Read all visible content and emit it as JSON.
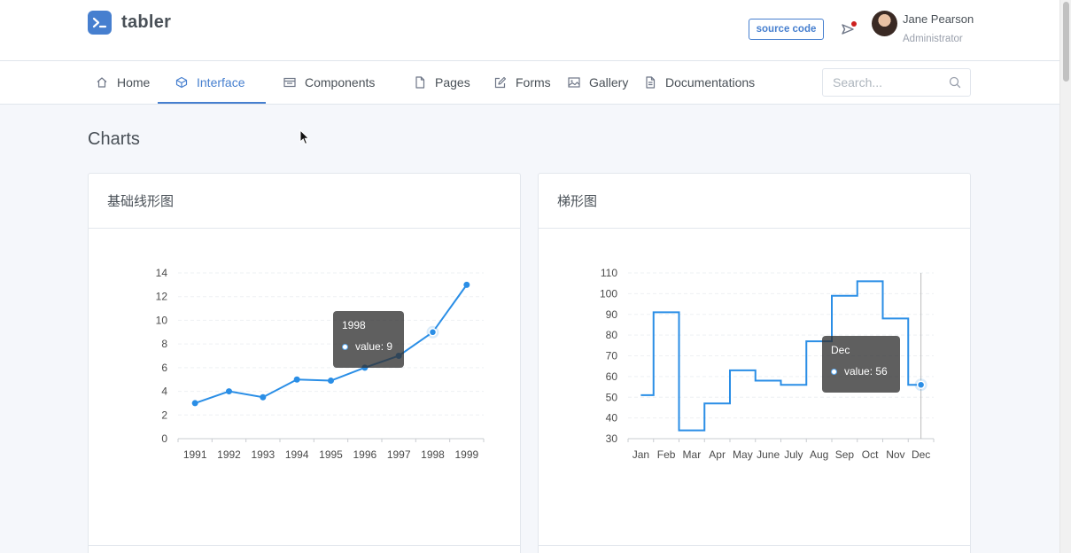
{
  "header": {
    "logo_text": "tabler",
    "source_button": "source code",
    "user_name": "Jane Pearson",
    "user_role": "Administrator"
  },
  "nav": {
    "items": [
      {
        "label": "Home",
        "icon": "home-icon"
      },
      {
        "label": "Interface",
        "icon": "box-icon",
        "active": true
      },
      {
        "label": "Components",
        "icon": "calendar-icon"
      },
      {
        "label": "Pages",
        "icon": "file-icon"
      },
      {
        "label": "Forms",
        "icon": "edit-icon"
      },
      {
        "label": "Gallery",
        "icon": "image-icon"
      },
      {
        "label": "Documentations",
        "icon": "file-text-icon"
      }
    ],
    "search_placeholder": "Search..."
  },
  "page": {
    "title": "Charts"
  },
  "colors": {
    "primary": "#467fcf",
    "series": "#2a8ee6",
    "notification": "#cd201f"
  },
  "cards": [
    {
      "title": "基础线形图",
      "tooltip": {
        "title": "1998",
        "value": "value: 9"
      }
    },
    {
      "title": "梯形图",
      "tooltip": {
        "title": "Dec",
        "value": "value: 56"
      }
    }
  ],
  "chart_data": [
    {
      "type": "line",
      "title": "基础线形图",
      "x": [
        "1991",
        "1992",
        "1993",
        "1994",
        "1995",
        "1996",
        "1997",
        "1998",
        "1999"
      ],
      "values": [
        3,
        4,
        3.5,
        5,
        4.9,
        6,
        7,
        9,
        13
      ],
      "ylim": [
        0,
        14
      ],
      "yticks": [
        0,
        2,
        4,
        6,
        8,
        10,
        12,
        14
      ],
      "highlight_index": 7,
      "grid": true
    },
    {
      "type": "line",
      "step": true,
      "title": "梯形图",
      "x": [
        "Jan",
        "Feb",
        "Mar",
        "Apr",
        "May",
        "June",
        "July",
        "Aug",
        "Sep",
        "Oct",
        "Nov",
        "Dec"
      ],
      "values": [
        51,
        91,
        34,
        47,
        63,
        58,
        56,
        77,
        99,
        106,
        88,
        56
      ],
      "ylim": [
        30,
        110
      ],
      "yticks": [
        30,
        40,
        50,
        60,
        70,
        80,
        90,
        100,
        110
      ],
      "highlight_index": 11,
      "grid": true
    }
  ]
}
